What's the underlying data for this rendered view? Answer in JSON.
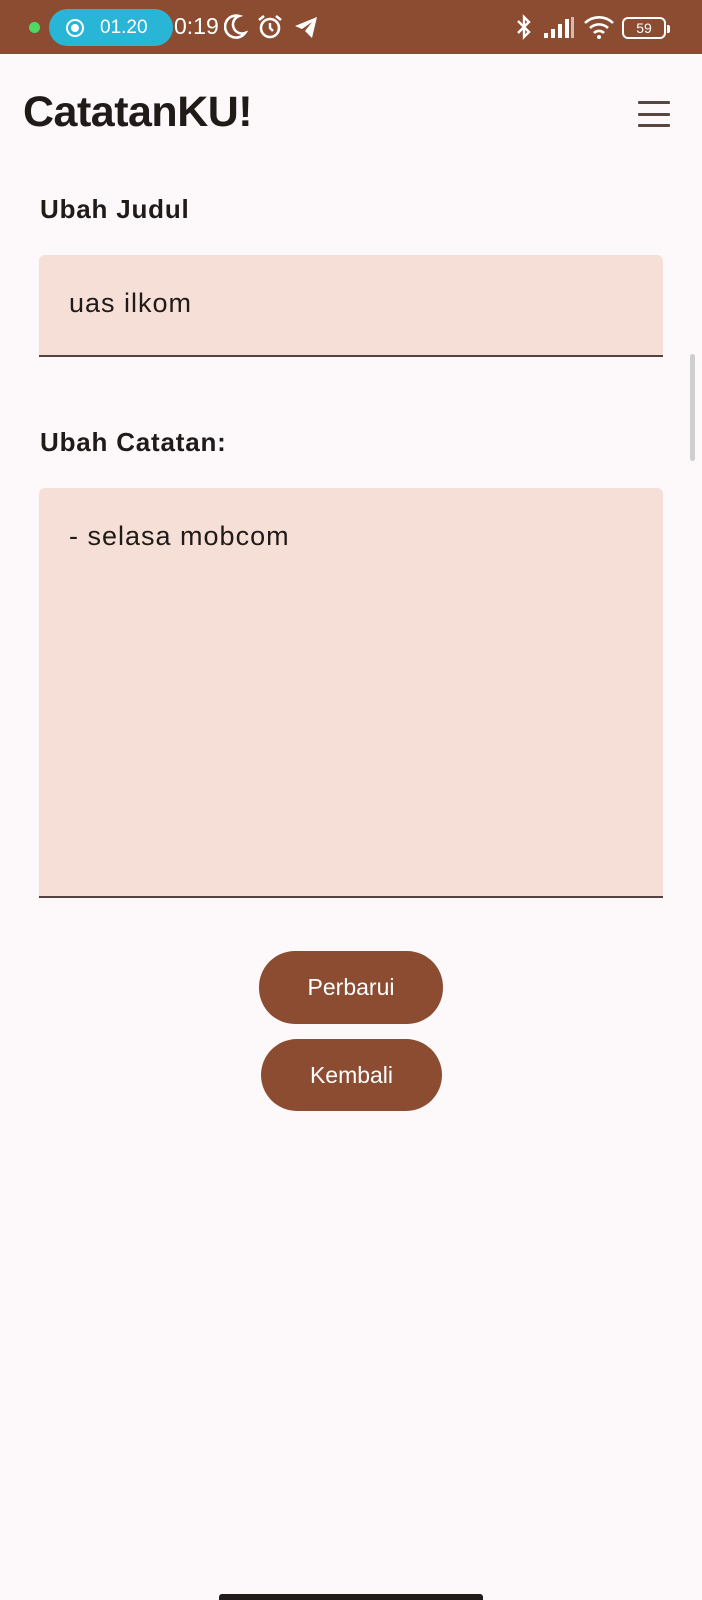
{
  "status_bar": {
    "recording_time": "01.20",
    "clock": "0:19",
    "battery": "59",
    "icons": [
      "recording-icon",
      "moon-icon",
      "alarm-icon",
      "telegram-icon",
      "bluetooth-icon",
      "signal-icon",
      "wifi-icon",
      "battery-icon"
    ],
    "background_color": "#8b4c31",
    "recording_pill_color": "#29b6d6"
  },
  "app_bar": {
    "title": "CatatanKU!",
    "menu_icon": "hamburger-menu-icon"
  },
  "form": {
    "title_label": "Ubah Judul",
    "title_value": "uas ilkom",
    "note_label": "Ubah Catatan:",
    "note_value": "- selasa mobcom",
    "field_color": "#f5dfd6"
  },
  "actions": {
    "update_label": "Perbarui",
    "back_label": "Kembali",
    "button_color": "#8b4c31"
  }
}
